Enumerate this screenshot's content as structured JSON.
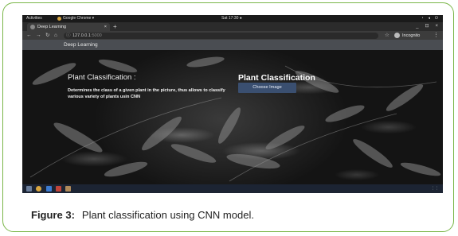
{
  "os_bar": {
    "activities": "Activities",
    "app_name": "Google Chrome ▾",
    "clock": "Sat 17:30 ●",
    "system_icons": [
      "wifi-icon",
      "volume-icon",
      "power-icon"
    ]
  },
  "browser": {
    "tab_title": "Deep Learning",
    "tab_close": "×",
    "new_tab": "+",
    "url_host": "127.0.0.1",
    "url_port": ":5000",
    "incognito_label": "Incognito",
    "window_controls": [
      "_",
      "⊡",
      "×"
    ]
  },
  "webpage": {
    "nav_brand": "Deep Learning",
    "left_heading": "Plant Classification :",
    "description": "Determines the class of a given plant in the picture, thus allows to classify various variety of plants usin CNN",
    "right_heading": "Plant Classification",
    "choose_button": "Choose Image"
  },
  "figure": {
    "label": "Figure 3:",
    "caption": "Plant classification using CNN model."
  },
  "colors": {
    "frame_border": "#7ab648",
    "navbar": "#4a4d52",
    "button": "#3a4f70"
  }
}
